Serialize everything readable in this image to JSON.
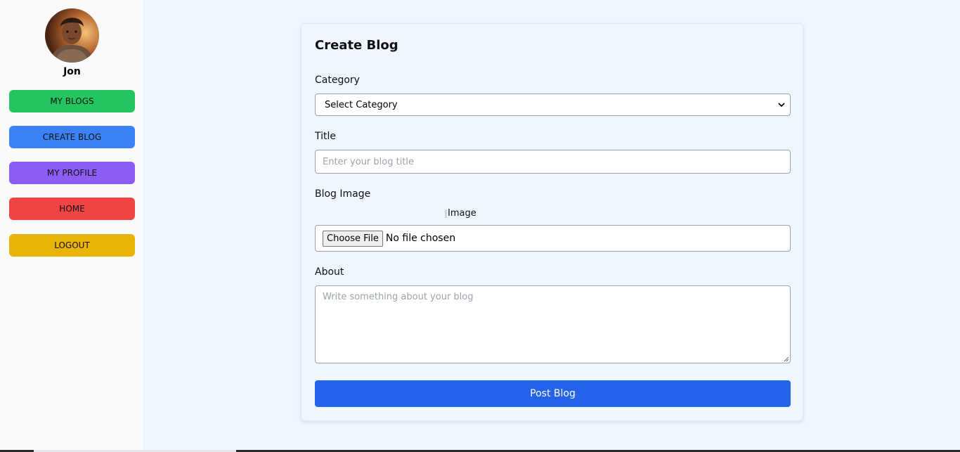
{
  "user": {
    "name": "Jon",
    "avatar_alt": "profile avatar"
  },
  "sidebar": {
    "items": [
      {
        "label": "MY BLOGS",
        "color": "#22c55e"
      },
      {
        "label": "CREATE BLOG",
        "color": "#3b82f6"
      },
      {
        "label": "MY PROFILE",
        "color": "#8b5cf6"
      },
      {
        "label": "HOME",
        "color": "#ef4444"
      },
      {
        "label": "LOGOUT",
        "color": "#eab308"
      }
    ]
  },
  "form": {
    "title": "Create Blog",
    "category_label": "Category",
    "category_selected": "Select Category",
    "title_label": "Title",
    "title_placeholder": "Enter your blog title",
    "image_label": "Blog Image",
    "image_alt": "Image",
    "file_button": "Choose File",
    "file_status": "No file chosen",
    "about_label": "About",
    "about_placeholder": "Write something about your blog",
    "submit_label": "Post Blog"
  },
  "colors": {
    "primary": "#2563eb",
    "background": "#eff6ff"
  }
}
